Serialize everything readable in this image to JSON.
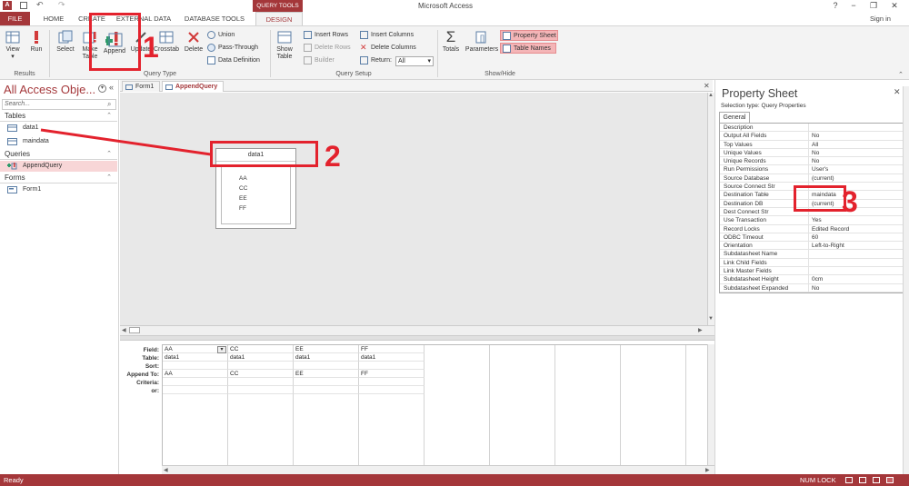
{
  "app": {
    "title": "Microsoft Access",
    "context_tab": "QUERY TOOLS",
    "sign_in": "Sign in",
    "help": "?",
    "minimize": "−",
    "restore": "❐",
    "close": "✕"
  },
  "ribbon_tabs": [
    "FILE",
    "HOME",
    "CREATE",
    "EXTERNAL DATA",
    "DATABASE TOOLS",
    "DESIGN"
  ],
  "ribbon": {
    "results": {
      "group": "Results",
      "view": "View",
      "run": "Run"
    },
    "query_type": {
      "group": "Query Type",
      "select": "Select",
      "make_table": "Make Table",
      "append": "Append",
      "update": "Update",
      "crosstab": "Crosstab",
      "delete": "Delete",
      "union": "Union",
      "pass_through": "Pass-Through",
      "data_definition": "Data Definition"
    },
    "query_setup": {
      "group": "Query Setup",
      "show_table": "Show Table",
      "insert_rows": "Insert Rows",
      "delete_rows": "Delete Rows",
      "builder": "Builder",
      "insert_columns": "Insert Columns",
      "delete_columns": "Delete Columns",
      "return_label": "Return:",
      "return_value": "All"
    },
    "show_hide": {
      "group": "Show/Hide",
      "totals": "Totals",
      "parameters": "Parameters",
      "property_sheet": "Property Sheet",
      "table_names": "Table Names"
    }
  },
  "nav": {
    "title": "All Access Obje...",
    "search_placeholder": "Search...",
    "sections": [
      {
        "label": "Tables",
        "items": [
          "data1",
          "maindata"
        ]
      },
      {
        "label": "Queries",
        "items": [
          "AppendQuery"
        ]
      },
      {
        "label": "Forms",
        "items": [
          "Form1"
        ]
      }
    ]
  },
  "doc_tabs": [
    "Form1",
    "AppendQuery"
  ],
  "design": {
    "table_name": "data1",
    "fields": [
      "AA",
      "CC",
      "EE",
      "FF"
    ]
  },
  "qbe": {
    "row_labels": [
      "Field:",
      "Table:",
      "Sort:",
      "Append To:",
      "Criteria:",
      "or:"
    ],
    "columns": [
      {
        "field": "AA",
        "table": "data1",
        "sort": "",
        "append_to": "AA"
      },
      {
        "field": "CC",
        "table": "data1",
        "sort": "",
        "append_to": "CC"
      },
      {
        "field": "EE",
        "table": "data1",
        "sort": "",
        "append_to": "EE"
      },
      {
        "field": "FF",
        "table": "data1",
        "sort": "",
        "append_to": "FF"
      }
    ]
  },
  "property_sheet": {
    "title": "Property Sheet",
    "selection_type": "Selection type:  Query Properties",
    "tab": "General",
    "rows": [
      {
        "name": "Description",
        "value": ""
      },
      {
        "name": "Output All Fields",
        "value": "No"
      },
      {
        "name": "Top Values",
        "value": "All"
      },
      {
        "name": "Unique Values",
        "value": "No"
      },
      {
        "name": "Unique Records",
        "value": "No"
      },
      {
        "name": "Run Permissions",
        "value": "User's"
      },
      {
        "name": "Source Database",
        "value": "(current)"
      },
      {
        "name": "Source Connect Str",
        "value": ""
      },
      {
        "name": "Destination Table",
        "value": "maindata"
      },
      {
        "name": "Destination DB",
        "value": "(current)"
      },
      {
        "name": "Dest Connect Str",
        "value": ""
      },
      {
        "name": "Use Transaction",
        "value": "Yes"
      },
      {
        "name": "Record Locks",
        "value": "Edited Record"
      },
      {
        "name": "ODBC Timeout",
        "value": "60"
      },
      {
        "name": "Orientation",
        "value": "Left-to-Right"
      },
      {
        "name": "Subdatasheet Name",
        "value": ""
      },
      {
        "name": "Link Child Fields",
        "value": ""
      },
      {
        "name": "Link Master Fields",
        "value": ""
      },
      {
        "name": "Subdatasheet Height",
        "value": "0cm"
      },
      {
        "name": "Subdatasheet Expanded",
        "value": "No"
      }
    ]
  },
  "status": {
    "left": "Ready",
    "right": "NUM LOCK"
  },
  "annotations": {
    "one": "1",
    "two": "2",
    "three": "3",
    "color": "#e3222d"
  },
  "colors": {
    "access_red": "#a4373a",
    "highlight": "#f4b5b7"
  }
}
